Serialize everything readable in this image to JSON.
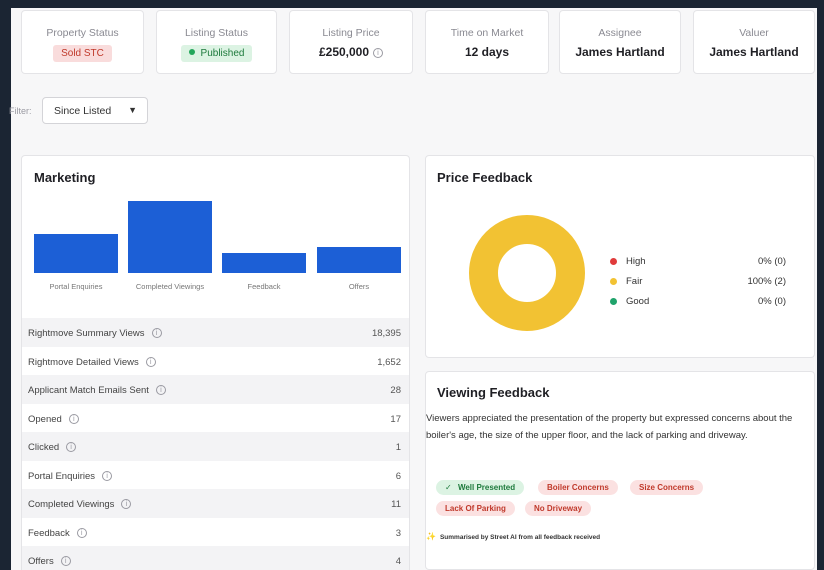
{
  "stats": {
    "property_status": {
      "label": "Property Status",
      "value": "Sold STC"
    },
    "listing_status": {
      "label": "Listing Status",
      "value": "Published"
    },
    "listing_price": {
      "label": "Listing Price",
      "value": "£250,000"
    },
    "time_on_market": {
      "label": "Time on Market",
      "value": "12 days"
    },
    "assignee": {
      "label": "Assignee",
      "value": "James Hartland"
    },
    "valuer": {
      "label": "Valuer",
      "value": "James Hartland"
    }
  },
  "filter": {
    "label": "Filter:",
    "value": "Since Listed"
  },
  "marketing": {
    "title": "Marketing",
    "chart_data": {
      "type": "bar",
      "categories": [
        "Portal Enquiries",
        "Completed Viewings",
        "Feedback",
        "Offers"
      ],
      "values": [
        6,
        11,
        3,
        4
      ],
      "ylim": [
        0,
        11
      ],
      "color": "#1c5fd6"
    },
    "rows": [
      {
        "label": "Rightmove Summary Views",
        "info": true,
        "value": "18,395"
      },
      {
        "label": "Rightmove Detailed Views",
        "info": true,
        "value": "1,652"
      },
      {
        "label": "Applicant Match Emails Sent",
        "info": true,
        "value": "28"
      },
      {
        "label": "Opened",
        "info": true,
        "value": "17"
      },
      {
        "label": "Clicked",
        "info": true,
        "value": "1"
      },
      {
        "label": "Portal Enquiries",
        "info": true,
        "value": "6"
      },
      {
        "label": "Completed Viewings",
        "info": true,
        "value": "11"
      },
      {
        "label": "Feedback",
        "info": true,
        "value": "3"
      },
      {
        "label": "Offers",
        "info": true,
        "value": "4"
      }
    ]
  },
  "price_feedback": {
    "title": "Price Feedback",
    "chart_data": {
      "type": "pie",
      "categories": [
        "High",
        "Fair",
        "Good"
      ],
      "values": [
        0,
        100,
        0
      ],
      "counts": [
        0,
        2,
        0
      ],
      "colors": [
        "#e03b3b",
        "#f2c233",
        "#1fa36b"
      ]
    },
    "legend": [
      {
        "name": "High",
        "value": "0% (0)",
        "color": "#e03b3b"
      },
      {
        "name": "Fair",
        "value": "100% (2)",
        "color": "#f2c233"
      },
      {
        "name": "Good",
        "value": "0% (0)",
        "color": "#1fa36b"
      }
    ]
  },
  "viewing_feedback": {
    "title": "Viewing Feedback",
    "summary": "Viewers appreciated the presentation of the property but expressed concerns about the boiler's age, the size of the upper floor, and the lack of parking and driveway.",
    "tags": [
      {
        "label": "Well Presented",
        "positive": true
      },
      {
        "label": "Boiler Concerns",
        "positive": false
      },
      {
        "label": "Size Concerns",
        "positive": false
      },
      {
        "label": "Lack Of Parking",
        "positive": false
      },
      {
        "label": "No Driveway",
        "positive": false
      }
    ],
    "ai_note": "Summarised by Street AI from all feedback received"
  },
  "colors": {
    "accent": "#1c5fd6",
    "background": "#1b2533"
  }
}
